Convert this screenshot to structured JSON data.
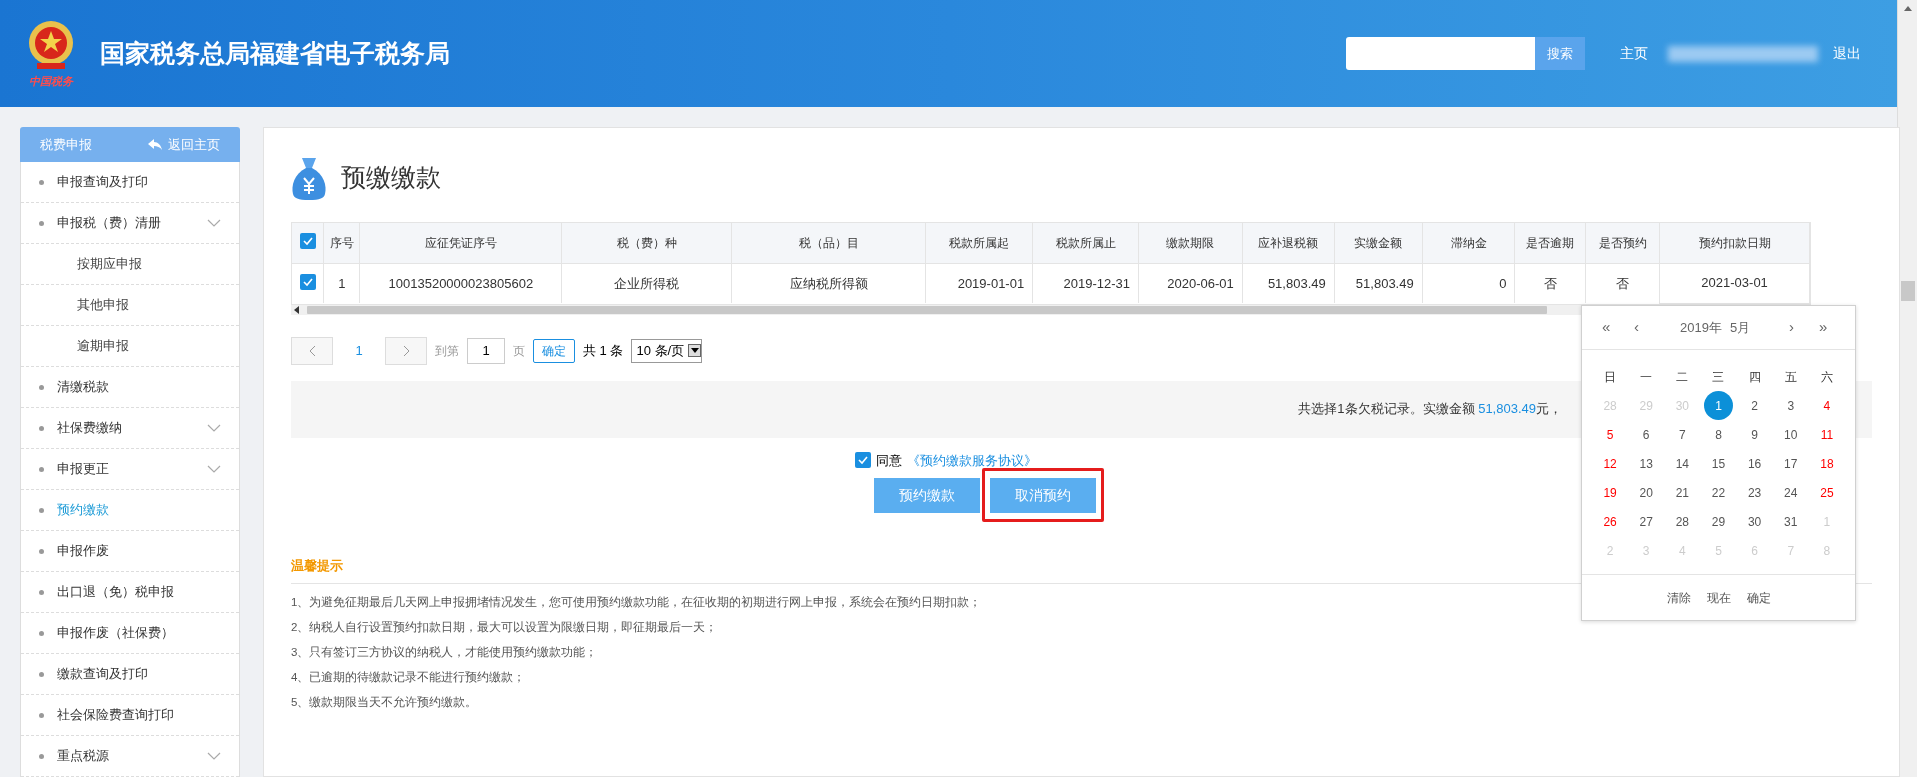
{
  "header": {
    "logo_text": "中国税务",
    "title": "国家税务总局福建省电子税务局",
    "search": {
      "button": "搜索"
    },
    "links": [
      "主页",
      "退出"
    ]
  },
  "sidebar": {
    "title": "税费申报",
    "back": "返回主页",
    "items": [
      {
        "label": "申报查询及打印",
        "selected": false,
        "expandable": false
      },
      {
        "label": "申报税（费）清册",
        "selected": false,
        "expandable": true,
        "children": [
          {
            "label": "按期应申报",
            "selected": false
          },
          {
            "label": "其他申报",
            "selected": false
          },
          {
            "label": "逾期申报",
            "selected": false
          }
        ]
      },
      {
        "label": "清缴税款",
        "selected": false,
        "expandable": false
      },
      {
        "label": "社保费缴纳",
        "selected": false,
        "expandable": true
      },
      {
        "label": "申报更正",
        "selected": false,
        "expandable": true
      },
      {
        "label": "预约缴款",
        "selected": true,
        "expandable": false
      },
      {
        "label": "申报作废",
        "selected": false,
        "expandable": false
      },
      {
        "label": "出口退（免）税申报",
        "selected": false,
        "expandable": false
      },
      {
        "label": "申报作废（社保费）",
        "selected": false,
        "expandable": false
      },
      {
        "label": "缴款查询及打印",
        "selected": false,
        "expandable": false
      },
      {
        "label": "社会保险费查询打印",
        "selected": false,
        "expandable": false
      },
      {
        "label": "重点税源",
        "selected": false,
        "expandable": true
      }
    ]
  },
  "page_title": "预缴缴款",
  "table": {
    "all_checked": true,
    "columns": [
      "序号",
      "应征凭证序号",
      "税（费）种",
      "税（品）目",
      "税款所属起",
      "税款所属止",
      "缴款期限",
      "应补退税额",
      "实缴金额",
      "滞纳金",
      "是否逾期",
      "是否预约",
      "预约扣款日期"
    ],
    "rows": [
      {
        "checked": true,
        "cells": [
          "1",
          "10013520000023805602",
          "企业所得税",
          "应纳税所得额",
          "2019-01-01",
          "2019-12-31",
          "2020-06-01",
          "51,803.49",
          "51,803.49",
          "0",
          "否",
          "否",
          "2021-03-01"
        ]
      }
    ]
  },
  "pagination": {
    "page": "1",
    "goto_label": "到第",
    "goto_value": "1",
    "page_unit": "页",
    "confirm": "确定",
    "total": "共 1 条",
    "page_size": "10 条/页"
  },
  "summary": {
    "text": "共选择1条欠税记录。实缴金额",
    "amount": "51,803.49",
    "unit": "元，"
  },
  "agreement": {
    "checked": true,
    "label": "同意",
    "link": "《预约缴款服务协议》"
  },
  "buttons": [
    "预约缴款",
    "取消预约"
  ],
  "tips": {
    "title": "温馨提示",
    "lines": [
      "1、为避免征期最后几天网上申报拥堵情况发生，您可使用预约缴款功能，在征收期的初期进行网上申报，系统会在预约日期扣款；",
      "2、纳税人自行设置预约扣款日期，最大可以设置为限缴日期，即征期最后一天；",
      "3、只有签订三方协议的纳税人，才能使用预约缴款功能；",
      "4、已逾期的待缴款记录不能进行预约缴款；",
      "5、缴款期限当天不允许预约缴款。"
    ]
  },
  "calendar": {
    "nav": [
      "«",
      "‹",
      "›",
      "»"
    ],
    "year": "2019年",
    "month": "5月",
    "weekdays": [
      "日",
      "一",
      "二",
      "三",
      "四",
      "五",
      "六"
    ],
    "weeks": [
      [
        {
          "text": "28",
          "kind": "outside",
          "selected": false
        },
        {
          "text": "29",
          "kind": "outside",
          "selected": false
        },
        {
          "text": "30",
          "kind": "outside",
          "selected": false
        },
        {
          "text": "1",
          "kind": "weekday",
          "selected": true
        },
        {
          "text": "2",
          "kind": "weekday",
          "selected": false
        },
        {
          "text": "3",
          "kind": "weekday",
          "selected": false
        },
        {
          "text": "4",
          "kind": "weekend",
          "selected": false
        }
      ],
      [
        {
          "text": "5",
          "kind": "weekend",
          "selected": false
        },
        {
          "text": "6",
          "kind": "weekday",
          "selected": false
        },
        {
          "text": "7",
          "kind": "weekday",
          "selected": false
        },
        {
          "text": "8",
          "kind": "weekday",
          "selected": false
        },
        {
          "text": "9",
          "kind": "weekday",
          "selected": false
        },
        {
          "text": "10",
          "kind": "weekday",
          "selected": false
        },
        {
          "text": "11",
          "kind": "weekend",
          "selected": false
        }
      ],
      [
        {
          "text": "12",
          "kind": "weekend",
          "selected": false
        },
        {
          "text": "13",
          "kind": "weekday",
          "selected": false
        },
        {
          "text": "14",
          "kind": "weekday",
          "selected": false
        },
        {
          "text": "15",
          "kind": "weekday",
          "selected": false
        },
        {
          "text": "16",
          "kind": "weekday",
          "selected": false
        },
        {
          "text": "17",
          "kind": "weekday",
          "selected": false
        },
        {
          "text": "18",
          "kind": "weekend",
          "selected": false
        }
      ],
      [
        {
          "text": "19",
          "kind": "weekend",
          "selected": false
        },
        {
          "text": "20",
          "kind": "weekday",
          "selected": false
        },
        {
          "text": "21",
          "kind": "weekday",
          "selected": false
        },
        {
          "text": "22",
          "kind": "weekday",
          "selected": false
        },
        {
          "text": "23",
          "kind": "weekday",
          "selected": false
        },
        {
          "text": "24",
          "kind": "weekday",
          "selected": false
        },
        {
          "text": "25",
          "kind": "weekend",
          "selected": false
        }
      ],
      [
        {
          "text": "26",
          "kind": "weekend",
          "selected": false
        },
        {
          "text": "27",
          "kind": "weekday",
          "selected": false
        },
        {
          "text": "28",
          "kind": "weekday",
          "selected": false
        },
        {
          "text": "29",
          "kind": "weekday",
          "selected": false
        },
        {
          "text": "30",
          "kind": "weekday",
          "selected": false
        },
        {
          "text": "31",
          "kind": "weekday",
          "selected": false
        },
        {
          "text": "1",
          "kind": "outside",
          "selected": false
        }
      ],
      [
        {
          "text": "2",
          "kind": "outside",
          "selected": false
        },
        {
          "text": "3",
          "kind": "outside",
          "selected": false
        },
        {
          "text": "4",
          "kind": "outside",
          "selected": false
        },
        {
          "text": "5",
          "kind": "outside",
          "selected": false
        },
        {
          "text": "6",
          "kind": "outside",
          "selected": false
        },
        {
          "text": "7",
          "kind": "outside",
          "selected": false
        },
        {
          "text": "8",
          "kind": "outside",
          "selected": false
        }
      ]
    ],
    "actions": [
      "清除",
      "现在",
      "确定"
    ]
  }
}
